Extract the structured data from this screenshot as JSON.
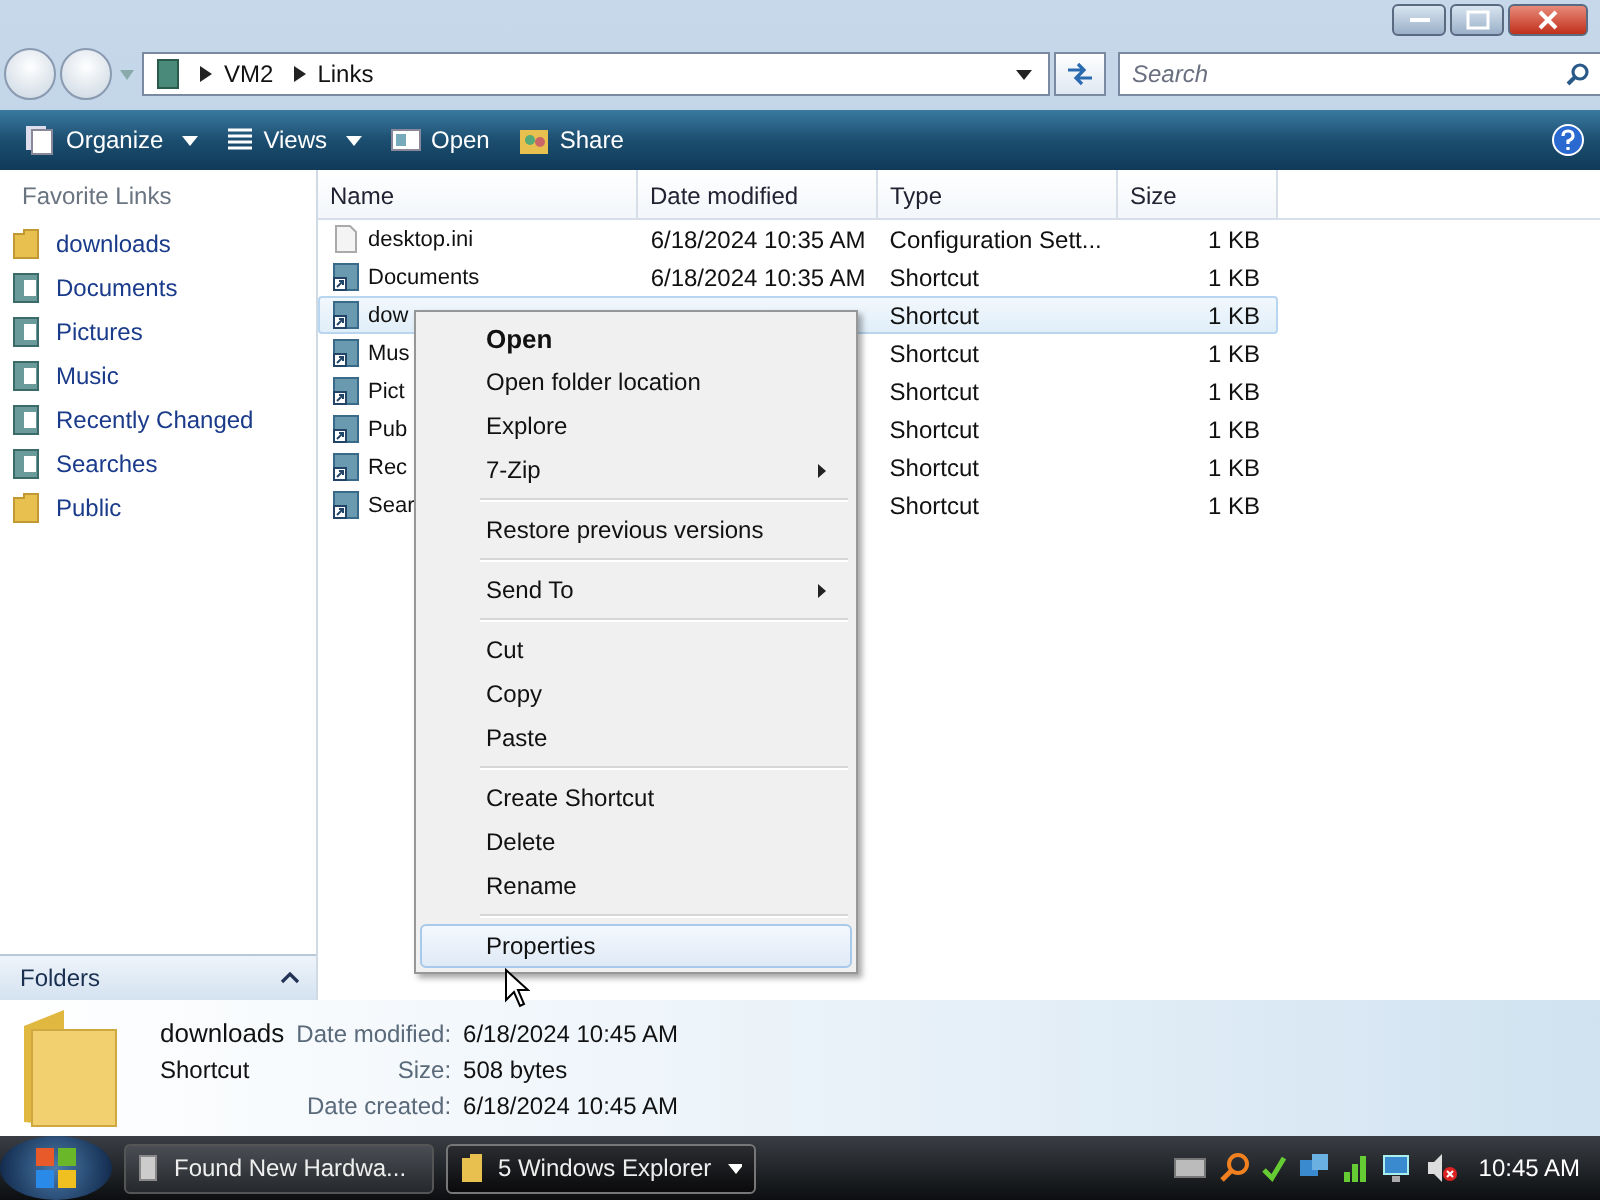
{
  "address_bar": {
    "path": [
      "VM2",
      "Links"
    ]
  },
  "search": {
    "placeholder": "Search"
  },
  "toolbar": [
    {
      "label": "Organize",
      "dropdown": true
    },
    {
      "label": "Views",
      "dropdown": true
    },
    {
      "label": "Open",
      "dropdown": false
    },
    {
      "label": "Share",
      "dropdown": false
    }
  ],
  "sidebar": {
    "title": "Favorite Links",
    "items": [
      {
        "label": "downloads",
        "kind": "folder"
      },
      {
        "label": "Documents",
        "kind": "library"
      },
      {
        "label": "Pictures",
        "kind": "library"
      },
      {
        "label": "Music",
        "kind": "library"
      },
      {
        "label": "Recently Changed",
        "kind": "library"
      },
      {
        "label": "Searches",
        "kind": "library"
      },
      {
        "label": "Public",
        "kind": "folder"
      }
    ],
    "folders_label": "Folders"
  },
  "table": {
    "columns": [
      "Name",
      "Date modified",
      "Type",
      "Size"
    ],
    "rows": [
      {
        "name": "desktop.ini",
        "date": "6/18/2024 10:35 AM",
        "type": "Configuration Sett...",
        "size": "1 KB",
        "kind": "file",
        "selected": false
      },
      {
        "name": "Documents",
        "date": "6/18/2024 10:35 AM",
        "type": "Shortcut",
        "size": "1 KB",
        "kind": "shortcut",
        "selected": false
      },
      {
        "name": "dow",
        "type": "Shortcut",
        "size": "1 KB",
        "kind": "shortcut",
        "selected": true
      },
      {
        "name": "Mus",
        "type": "Shortcut",
        "size": "1 KB",
        "kind": "shortcut",
        "selected": false
      },
      {
        "name": "Pict",
        "type": "Shortcut",
        "size": "1 KB",
        "kind": "shortcut",
        "selected": false
      },
      {
        "name": "Pub",
        "type": "Shortcut",
        "size": "1 KB",
        "kind": "shortcut",
        "selected": false
      },
      {
        "name": "Rec",
        "type": "Shortcut",
        "size": "1 KB",
        "kind": "shortcut",
        "selected": false
      },
      {
        "name": "Sear",
        "type": "Shortcut",
        "size": "1 KB",
        "kind": "shortcut",
        "selected": false
      }
    ]
  },
  "context_menu": [
    {
      "kind": "item",
      "label": "Open",
      "default": true,
      "submenu": false,
      "selected": false
    },
    {
      "kind": "item",
      "label": "Open folder location",
      "default": false,
      "submenu": false,
      "selected": false
    },
    {
      "kind": "item",
      "label": "Explore",
      "default": false,
      "submenu": false,
      "selected": false
    },
    {
      "kind": "item",
      "label": "7-Zip",
      "default": false,
      "submenu": true,
      "selected": false
    },
    {
      "kind": "separator"
    },
    {
      "kind": "item",
      "label": "Restore previous versions",
      "default": false,
      "submenu": false,
      "selected": false
    },
    {
      "kind": "separator"
    },
    {
      "kind": "item",
      "label": "Send To",
      "default": false,
      "submenu": true,
      "selected": false
    },
    {
      "kind": "separator"
    },
    {
      "kind": "item",
      "label": "Cut",
      "default": false,
      "submenu": false,
      "selected": false
    },
    {
      "kind": "item",
      "label": "Copy",
      "default": false,
      "submenu": false,
      "selected": false
    },
    {
      "kind": "item",
      "label": "Paste",
      "default": false,
      "submenu": false,
      "selected": false
    },
    {
      "kind": "separator"
    },
    {
      "kind": "item",
      "label": "Create Shortcut",
      "default": false,
      "submenu": false,
      "selected": false
    },
    {
      "kind": "item",
      "label": "Delete",
      "default": false,
      "submenu": false,
      "selected": false
    },
    {
      "kind": "item",
      "label": "Rename",
      "default": false,
      "submenu": false,
      "selected": false
    },
    {
      "kind": "separator"
    },
    {
      "kind": "item",
      "label": "Properties",
      "default": false,
      "submenu": false,
      "selected": true
    }
  ],
  "details": {
    "name": "downloads",
    "type": "Shortcut",
    "fields": [
      {
        "label": "Date modified:",
        "value": "6/18/2024 10:45 AM"
      },
      {
        "label": "Size:",
        "value": "508 bytes"
      },
      {
        "label": "Date created:",
        "value": "6/18/2024 10:45 AM"
      }
    ]
  },
  "taskbar": {
    "buttons": [
      {
        "label": "Found New Hardwa...",
        "selected": false
      },
      {
        "label": "5 Windows Explorer",
        "selected": true
      }
    ],
    "clock": "10:45 AM"
  }
}
